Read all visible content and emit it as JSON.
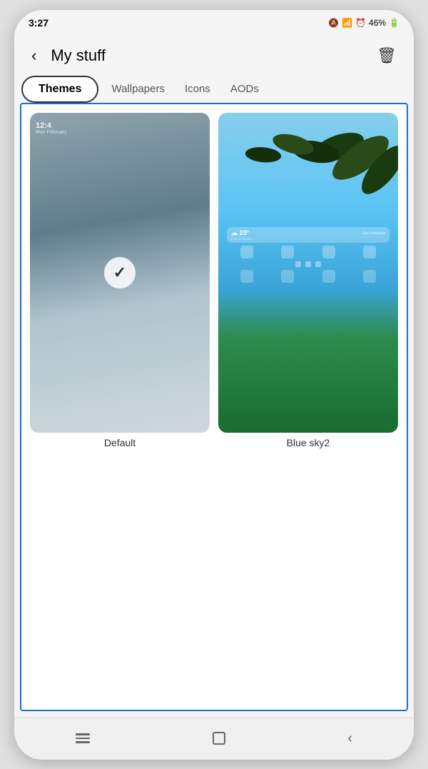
{
  "statusBar": {
    "time": "3:27",
    "icons": "🔕 📶 ⏰ 46% 🔋"
  },
  "header": {
    "backLabel": "‹",
    "title": "My stuff",
    "deleteLabel": "🗑"
  },
  "tabs": {
    "activeTab": "Themes",
    "tabs": [
      "Themes",
      "Wallpapers",
      "Icons",
      "AODs"
    ]
  },
  "themes": [
    {
      "id": "default",
      "label": "Default",
      "selected": true
    },
    {
      "id": "bluesky2",
      "label": "Blue sky2",
      "selected": false
    }
  ],
  "bottomNav": {
    "recentApps": "|||",
    "home": "□",
    "back": "‹"
  }
}
